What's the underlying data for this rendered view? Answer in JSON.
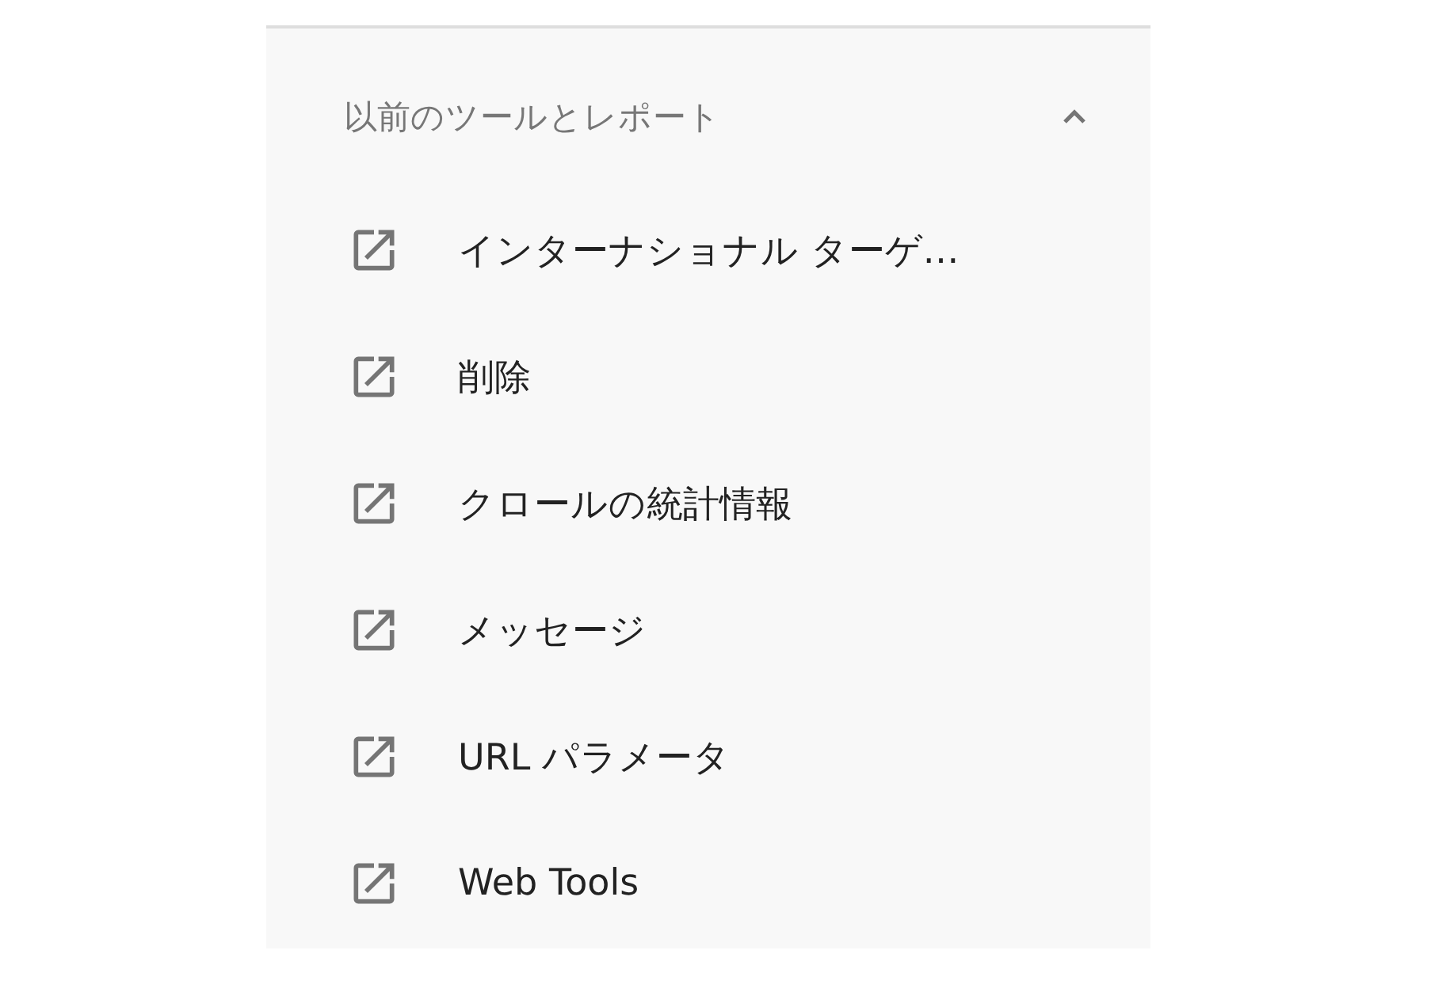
{
  "section": {
    "title": "以前のツールとレポート",
    "expanded": true,
    "items": [
      {
        "label": "インターナショナル ターゲ…"
      },
      {
        "label": "削除"
      },
      {
        "label": "クロールの統計情報"
      },
      {
        "label": "メッセージ"
      },
      {
        "label": "URL パラメータ"
      },
      {
        "label": "Web Tools"
      }
    ]
  }
}
